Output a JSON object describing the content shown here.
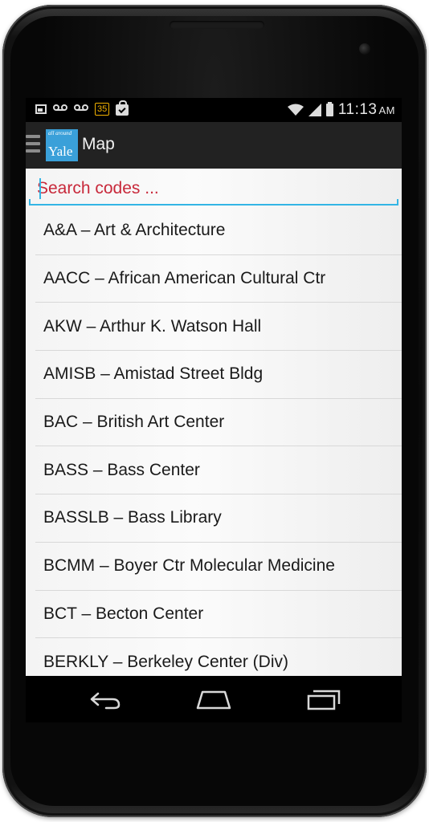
{
  "status_bar": {
    "notification_badge": "35",
    "time": "11:13",
    "ampm": "AM",
    "icons": [
      "picture-icon",
      "voicemail-icon",
      "voicemail-icon",
      "notification-badge-icon",
      "store-bag-icon",
      "wifi-icon",
      "signal-icon",
      "battery-icon"
    ]
  },
  "action_bar": {
    "logo_small": "all around",
    "logo_big": "Yale",
    "title": "Map"
  },
  "search": {
    "placeholder": "Search codes ...",
    "value": ""
  },
  "list": [
    "A&A – Art & Architecture",
    "AACC – African American Cultural Ctr",
    "AKW – Arthur K. Watson Hall",
    "AMISB – Amistad Street Bldg",
    "BAC – British Art Center",
    "BASS – Bass Center",
    "BASSLB – Bass Library",
    "BCMM – Boyer Ctr Molecular Medicine",
    "BCT – Becton Center",
    "BERKLY – Berkeley Center (Div)"
  ],
  "nav_bar": {
    "buttons": [
      "back-icon",
      "home-icon",
      "recent-apps-icon"
    ]
  },
  "colors": {
    "action_bar": "#222222",
    "logo_bg": "#3aa0d9",
    "placeholder": "#c8283a",
    "accent": "#33b5e5"
  }
}
